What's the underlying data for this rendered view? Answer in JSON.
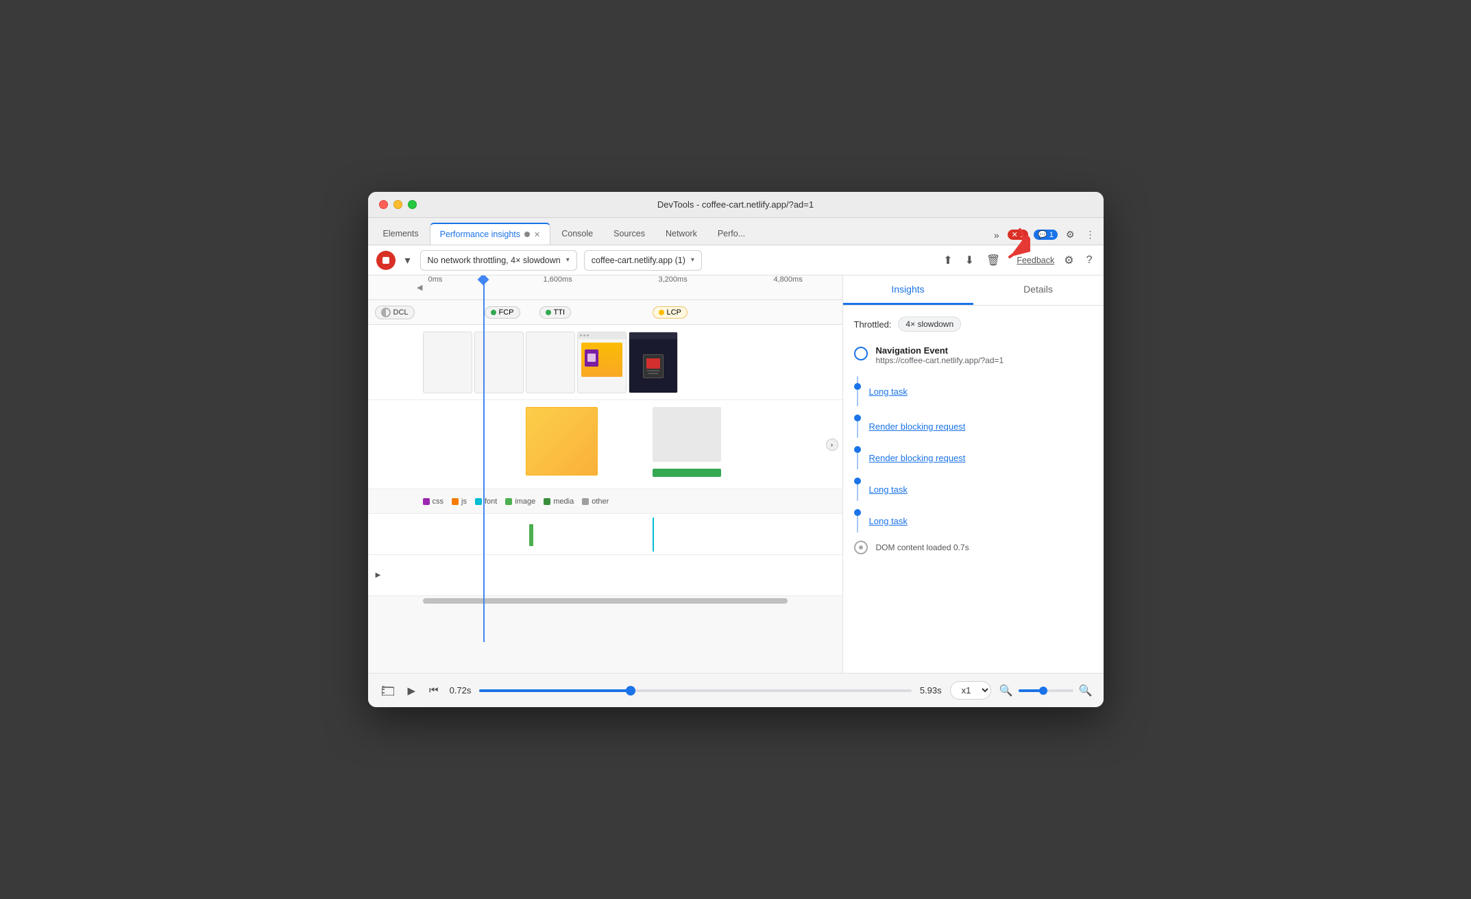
{
  "window": {
    "title": "DevTools - coffee-cart.netlify.app/?ad=1"
  },
  "tabs": [
    {
      "label": "Elements",
      "active": false,
      "closeable": false
    },
    {
      "label": "Performance insights",
      "active": true,
      "closeable": true
    },
    {
      "label": "Console",
      "active": false,
      "closeable": false
    },
    {
      "label": "Sources",
      "active": false,
      "closeable": false
    },
    {
      "label": "Network",
      "active": false,
      "closeable": false
    },
    {
      "label": "Perfo...",
      "active": false,
      "closeable": false
    }
  ],
  "toolbar": {
    "throttle_label": "No network throttling, 4× slowdown",
    "url_label": "coffee-cart.netlify.app (1)",
    "feedback_label": "Feedback"
  },
  "timeline": {
    "timestamps": [
      "0ms",
      "1,600ms",
      "3,200ms",
      "4,800ms"
    ],
    "markers": [
      {
        "label": "DCL",
        "color": "grey"
      },
      {
        "label": "FCP",
        "color": "green"
      },
      {
        "label": "TTI",
        "color": "green"
      },
      {
        "label": "LCP",
        "color": "orange"
      }
    ],
    "legend": [
      {
        "label": "css",
        "color": "#9c27b0"
      },
      {
        "label": "js",
        "color": "#f57c00"
      },
      {
        "label": "font",
        "color": "#00bcd4"
      },
      {
        "label": "image",
        "color": "#4caf50"
      },
      {
        "label": "media",
        "color": "#388e3c"
      },
      {
        "label": "other",
        "color": "#9e9e9e"
      }
    ]
  },
  "insights_panel": {
    "tabs": [
      {
        "label": "Insights",
        "active": true
      },
      {
        "label": "Details",
        "active": false
      }
    ],
    "throttled_label": "Throttled:",
    "throttled_value": "4× slowdown",
    "nav_event": {
      "title": "Navigation Event",
      "url": "https://coffee-cart.netlify.app/?ad=1"
    },
    "items": [
      {
        "label": "Long task",
        "type": "link"
      },
      {
        "label": "Render blocking request",
        "type": "link"
      },
      {
        "label": "Render blocking request",
        "type": "link"
      },
      {
        "label": "Long task",
        "type": "link"
      },
      {
        "label": "Long task",
        "type": "link"
      }
    ],
    "dom_item": {
      "label": "DOM content loaded 0.7s"
    }
  },
  "bottom_bar": {
    "time_start": "0.72s",
    "time_end": "5.93s",
    "speed": "x1"
  }
}
